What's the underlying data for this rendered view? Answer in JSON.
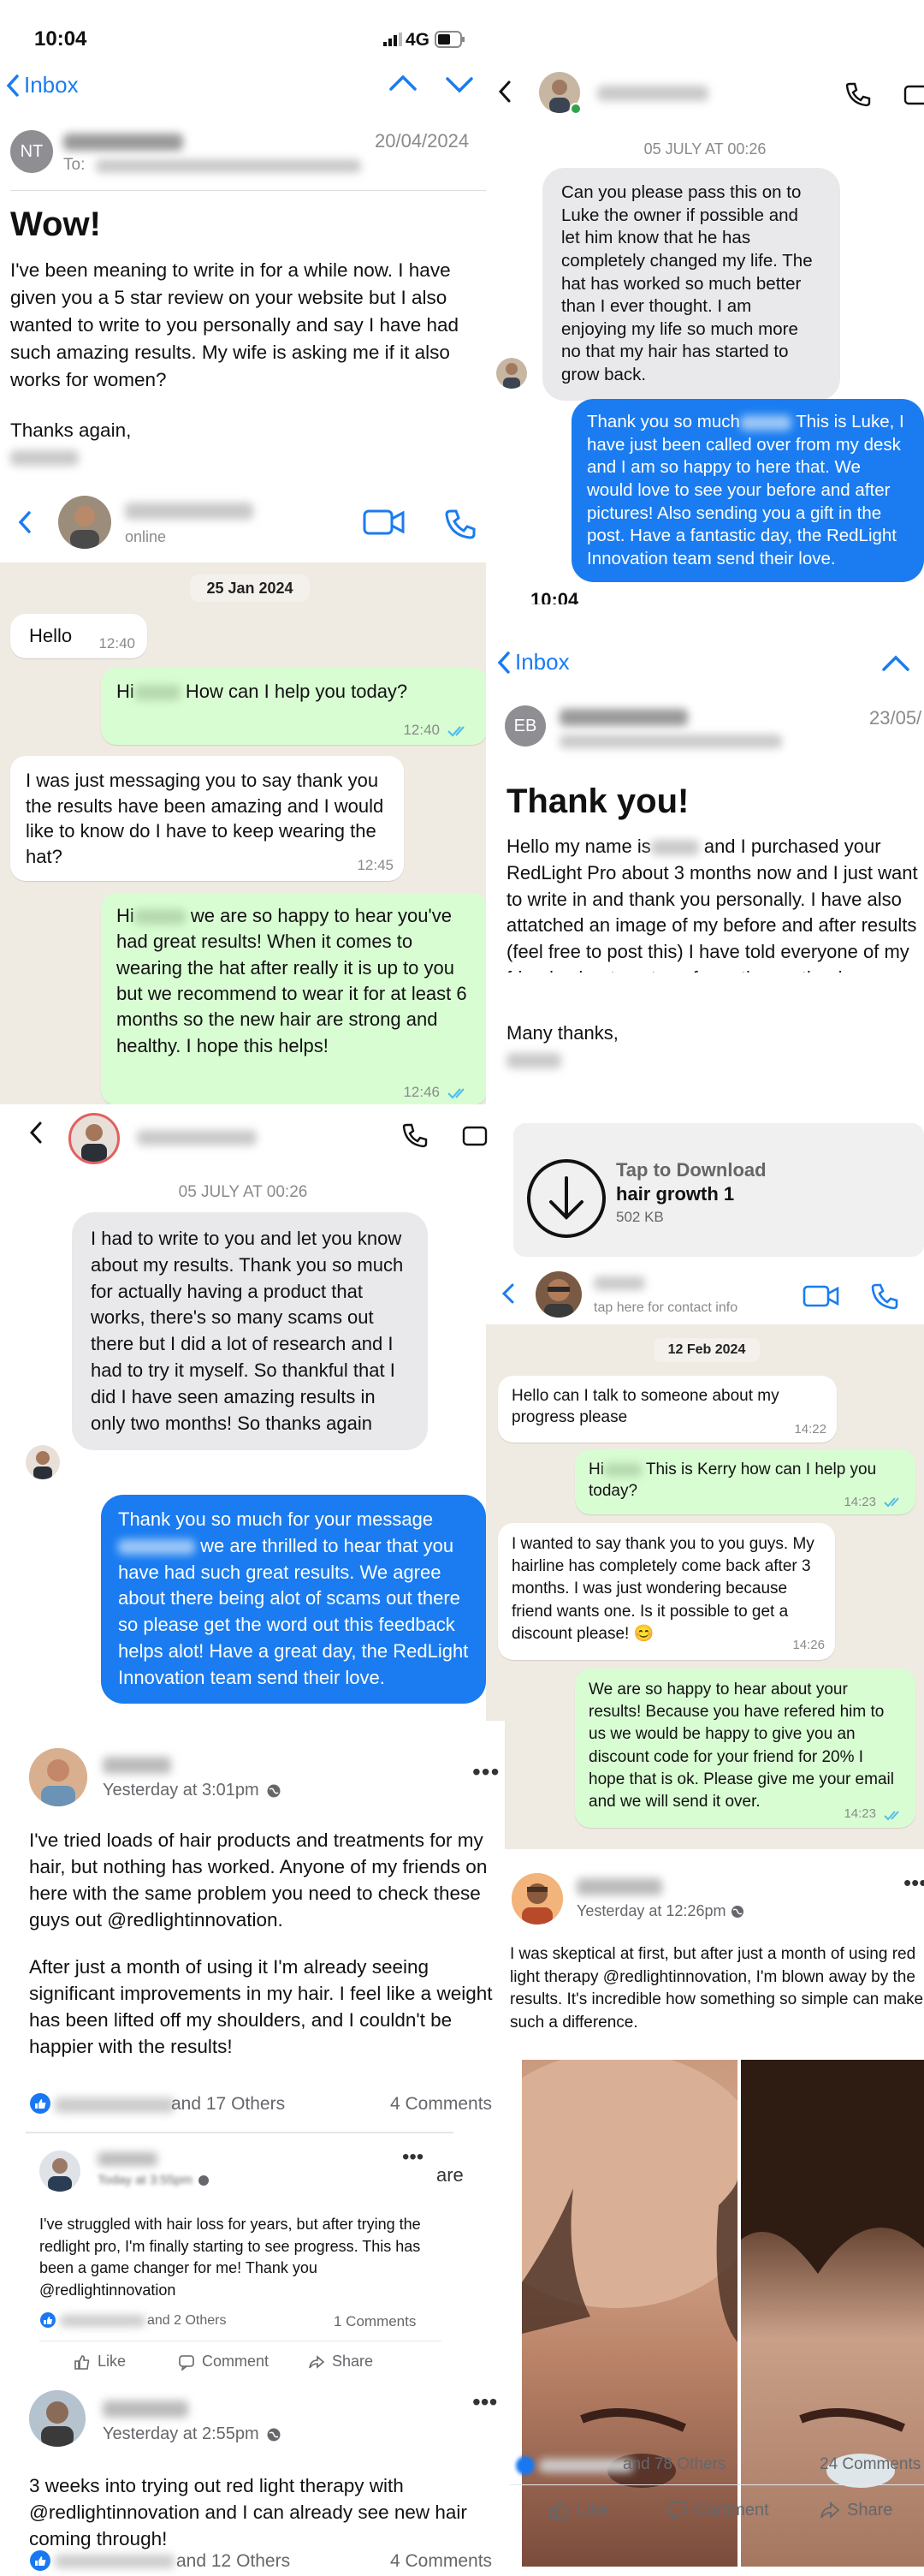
{
  "status": {
    "time": "10:04",
    "network": "4G"
  },
  "email1": {
    "back_label": "Inbox",
    "avatar_initials": "NT",
    "date": "20/04/2024",
    "to_label": "To:",
    "subject": "Wow!",
    "body": "I've been meaning to write in for a while now. I have given you a 5 star review on your website but I also wanted to write to you personally and say I have had such amazing results. My wife is asking me if it also works for women?",
    "signoff": "Thanks again,"
  },
  "msg1": {
    "date": "05 JULY AT 00:26",
    "incoming": "Can you please pass this on to Luke the owner if possible and let him know that he has completely changed my life. The hat has worked so much better than I ever thought. I am enjoying my life so much more no that my hair has started to grow back.",
    "outgoing_a": "Thank you so much",
    "outgoing_b": " This is Luke, I have just been called over from my desk and I am so happy to here that. We would love to see your before and after pictures! Also sending you a gift in the post. Have a fantastic day, the RedLight Innovation team send their love."
  },
  "wa1": {
    "status": "online",
    "date": "25 Jan 2024",
    "m1": "Hello",
    "m1_time": "12:40",
    "m2_a": "Hi",
    "m2_b": " How can I help you today?",
    "m2_time": "12:40",
    "m3": "I was just messaging you to say thank you the results have been amazing and I would like to know do I have to keep wearing the hat?",
    "m3_time": "12:45",
    "m4_a": "Hi",
    "m4_b": " we are so happy to hear you've had great results! When it comes to wearing the hat after really it is up to you but we recommend to wear it for at least 6 months so the new hair are strong and healthy. I hope this helps!",
    "m4_time": "12:46"
  },
  "email2": {
    "status_time": "10:04",
    "back_label": "Inbox",
    "avatar_initials": "EB",
    "date": "23/05/",
    "subject": "Thank you!",
    "body_a": "Hello my name is",
    "body_b": " and I purchased your RedLight Pro about 3 months now and I just want to write in and thank you personally. I have also attatched an image of my before and after results (feel free to post this) I have told everyone of my friends about my transformation so thank you again",
    "signoff": "Many thanks,",
    "attachment_action": "Tap to Download",
    "attachment_name": "hair growth 1",
    "attachment_size": "502 KB"
  },
  "msg2": {
    "date": "05 JULY AT 00:26",
    "incoming": "I had to write to you and let you know about my results. Thank you so much for actually having a product that works, there's so many scams out there but I did a lot of research and I had to try it myself. So thankful that I did I have seen amazing results in only two months! So thanks again",
    "outgoing_a": "Thank you so much for your message",
    "outgoing_b": " we are thrilled to hear that you have had such great results. We agree about there being alot of scams out there so please get the word out this feedback helps alot! Have a great day, the RedLight Innovation team send their love."
  },
  "wa2": {
    "status": "tap here for contact info",
    "date": "12 Feb 2024",
    "m1": "Hello can I talk to someone about my progress please",
    "m1_time": "14:22",
    "m2_a": "Hi",
    "m2_b": " This is Kerry how can I help you today?",
    "m2_time": "14:23",
    "m3": "I wanted to say thank you to you guys. My hairline has completely come back after 3 months. I was just wondering because friend wants one. Is it possible to get a discount please!",
    "m3_emoji": "😊",
    "m3_time": "14:26",
    "m4": "We are so happy to hear about your results! Because you have refered him to us we would be happy to give you an discount code for your friend for 20% I hope that is ok. Please give me your email and we will send it over.",
    "m4_time": "14:23"
  },
  "fb1": {
    "time": "Yesterday at 3:01pm",
    "body1": "I've tried loads of hair products and treatments for my hair, but nothing has worked. Anyone of my friends on here with the same problem you need to check these guys out @redlightinnovation.",
    "body2": "After just a month of using it I'm already seeing significant improvements in my hair. I feel like a weight has been lifted off my shoulders, and I couldn't be happier with the results!",
    "reactions": "and 17 Others",
    "comments": "4 Comments"
  },
  "fb2": {
    "time": "Today at 3:55pm",
    "body": "I've struggled with hair loss for years, but after trying the redlight pro, I'm finally starting to see progress. This has been a game changer for me! Thank you @redlightinnovation",
    "reactions": "and 2 Others",
    "comments": "1 Comments",
    "side_text": "are",
    "like": "Like",
    "comment": "Comment",
    "share": "Share"
  },
  "fb3": {
    "time": "Yesterday at 2:55pm",
    "body": "3 weeks into trying out red light therapy with @redlightinnovation and I can already see new hair coming through!",
    "reactions": "and 12 Others",
    "comments": "4 Comments"
  },
  "fb4": {
    "time": "Yesterday at 12:26pm",
    "body": "I was skeptical at first, but after just a month of using red light therapy @redlightinnovation, I'm blown away by the results. It's incredible how something so simple can make such a difference.",
    "reactions": "and 78 Others",
    "comments": "24 Comments",
    "like": "Like",
    "comment": "Comment",
    "share": "Share"
  }
}
